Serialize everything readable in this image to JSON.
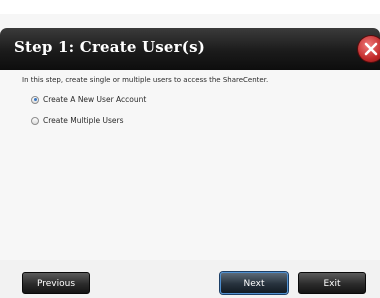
{
  "dialog": {
    "title": "Step 1: Create User(s)",
    "intro": "In this step, create single or multiple users to access the ShareCenter.",
    "options": [
      {
        "label": "Create A New User Account",
        "selected": true
      },
      {
        "label": "Create Multiple Users",
        "selected": false
      }
    ]
  },
  "buttons": {
    "previous": "Previous",
    "next": "Next",
    "exit": "Exit"
  },
  "colors": {
    "titlebar": "#1b1b1b",
    "close_icon": "#c22a2a",
    "accent": "#4f8fcf"
  },
  "icons": {
    "close": "close-icon"
  }
}
